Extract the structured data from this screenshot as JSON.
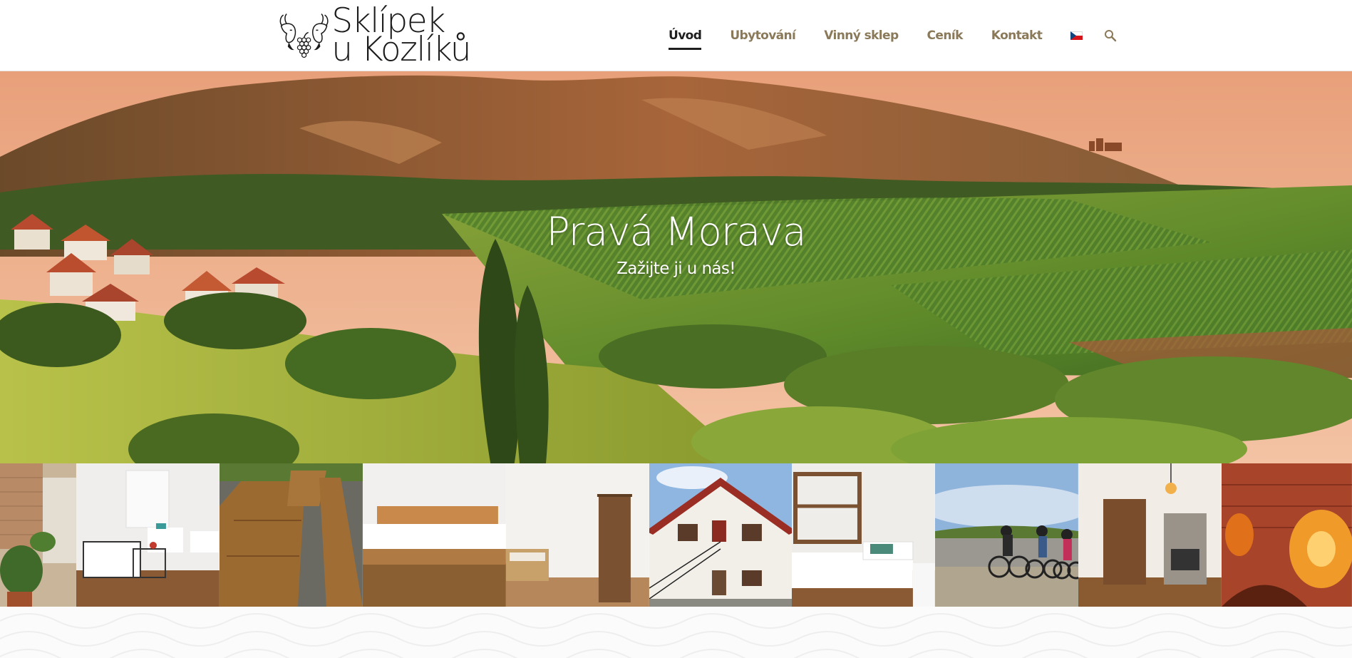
{
  "brand": {
    "line1": "Sklípek",
    "line2": "u Kozlíků"
  },
  "nav": {
    "items": [
      {
        "label": "Úvod",
        "active": true
      },
      {
        "label": "Ubytování",
        "active": false
      },
      {
        "label": "Vinný sklep",
        "active": false
      },
      {
        "label": "Ceník",
        "active": false
      },
      {
        "label": "Kontakt",
        "active": false
      }
    ],
    "language_icon": "czech-flag-icon",
    "search_icon": "search-icon"
  },
  "hero": {
    "title": "Pravá Morava",
    "subtitle": "Zažijte ji u nás!"
  },
  "colors": {
    "nav_text": "#8a7a5a",
    "nav_active": "#1e1e1e"
  }
}
